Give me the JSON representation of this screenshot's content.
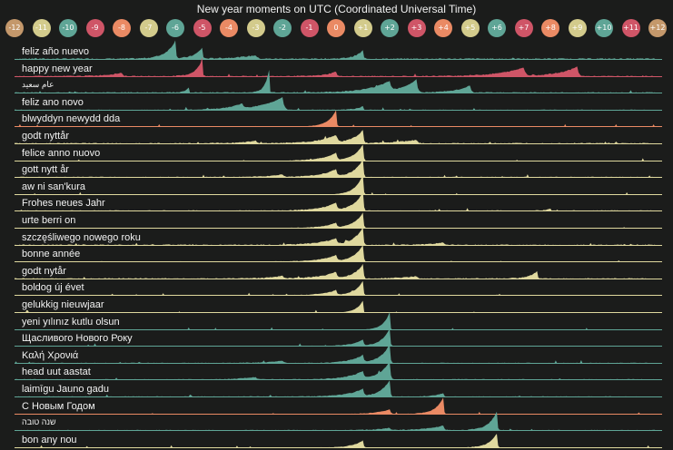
{
  "chart_data": {
    "type": "area",
    "title": "New year moments on UTC (Coordinated Universal Time)",
    "colors": {
      "green": "#5fa596",
      "red": "#cf5567",
      "orange": "#ea8a64",
      "yellow": "#dfd89e",
      "brown": "#c4986b",
      "background": "#1b1c1b"
    },
    "timezones": [
      {
        "label": "-12",
        "color": "#c4986b"
      },
      {
        "label": "-11",
        "color": "#d3cb8c"
      },
      {
        "label": "-10",
        "color": "#5fa596"
      },
      {
        "label": "-9",
        "color": "#cf5567"
      },
      {
        "label": "-8",
        "color": "#ea8a64"
      },
      {
        "label": "-7",
        "color": "#d3cb8c"
      },
      {
        "label": "-6",
        "color": "#5fa596"
      },
      {
        "label": "-5",
        "color": "#cf5567"
      },
      {
        "label": "-4",
        "color": "#ea8a64"
      },
      {
        "label": "-3",
        "color": "#d3cb8c"
      },
      {
        "label": "-2",
        "color": "#5fa596"
      },
      {
        "label": "-1",
        "color": "#cf5567"
      },
      {
        "label": "0",
        "color": "#ea8a64"
      },
      {
        "label": "+1",
        "color": "#d3cb8c"
      },
      {
        "label": "+2",
        "color": "#5fa596"
      },
      {
        "label": "+3",
        "color": "#cf5567"
      },
      {
        "label": "+4",
        "color": "#ea8a64"
      },
      {
        "label": "+5",
        "color": "#d3cb8c"
      },
      {
        "label": "+6",
        "color": "#5fa596"
      },
      {
        "label": "+7",
        "color": "#cf5567"
      },
      {
        "label": "+8",
        "color": "#ea8a64"
      },
      {
        "label": "+9",
        "color": "#d3cb8c"
      },
      {
        "label": "+10",
        "color": "#5fa596"
      },
      {
        "label": "+11",
        "color": "#cf5567"
      },
      {
        "label": "+12",
        "color": "#c4986b"
      }
    ],
    "xlim": [
      -12,
      12
    ],
    "series": [
      {
        "name": "feliz año nuevo",
        "color": "#5fa596",
        "base": 0.06,
        "peaks": [
          [
            -6,
            0.75,
            0.35
          ],
          [
            -5,
            0.45,
            0.3
          ],
          [
            1,
            0.35,
            0.3
          ],
          [
            -3,
            0.15,
            0.8
          ]
        ]
      },
      {
        "name": "happy new year",
        "color": "#cf5567",
        "base": 0.05,
        "peaks": [
          [
            -5,
            0.7,
            0.25
          ],
          [
            -8,
            0.15,
            0.6
          ],
          [
            7,
            0.35,
            0.9
          ],
          [
            9,
            0.4,
            0.7
          ],
          [
            0,
            0.2,
            0.4
          ]
        ]
      },
      {
        "name": "عام سعيد",
        "color": "#5fa596",
        "base": 0.05,
        "peaks": [
          [
            -2.5,
            1.0,
            0.15
          ],
          [
            2,
            0.4,
            0.8
          ],
          [
            3,
            0.55,
            0.6
          ],
          [
            5,
            0.3,
            0.5
          ],
          [
            -5.5,
            0.2,
            0.15
          ]
        ]
      },
      {
        "name": "feliz ano novo",
        "color": "#5fa596",
        "base": 0.04,
        "peaks": [
          [
            -2,
            0.55,
            0.8
          ],
          [
            -3.5,
            0.2,
            0.5
          ],
          [
            1,
            0.15,
            0.3
          ]
        ]
      },
      {
        "name": "blwyddyn newydd dda",
        "color": "#ea8a64",
        "base": 0.02,
        "peaks": [
          [
            0,
            0.7,
            0.3
          ]
        ]
      },
      {
        "name": "godt nyttår",
        "color": "#dfd89e",
        "base": 0.05,
        "peaks": [
          [
            1,
            0.55,
            0.4
          ],
          [
            0,
            0.3,
            0.7
          ],
          [
            3,
            0.15,
            0.8
          ],
          [
            -3,
            0.1,
            0.6
          ]
        ]
      },
      {
        "name": "felice anno nuovo",
        "color": "#dfd89e",
        "base": 0.03,
        "peaks": [
          [
            1,
            0.7,
            0.35
          ],
          [
            0,
            0.3,
            0.6
          ]
        ]
      },
      {
        "name": "gott nytt år",
        "color": "#dfd89e",
        "base": 0.04,
        "peaks": [
          [
            1,
            0.75,
            0.35
          ],
          [
            0,
            0.3,
            0.6
          ],
          [
            -2,
            0.1,
            0.6
          ]
        ]
      },
      {
        "name": "aw ni san'kura",
        "color": "#dfd89e",
        "base": 0.02,
        "peaks": [
          [
            1,
            0.85,
            0.3
          ]
        ]
      },
      {
        "name": "Frohes neues Jahr",
        "color": "#dfd89e",
        "base": 0.04,
        "peaks": [
          [
            1,
            0.8,
            0.35
          ],
          [
            0,
            0.3,
            0.6
          ],
          [
            8,
            0.08,
            0.2
          ]
        ]
      },
      {
        "name": "urte berri on",
        "color": "#dfd89e",
        "base": 0.03,
        "peaks": [
          [
            1,
            0.65,
            0.35
          ],
          [
            0,
            0.2,
            0.5
          ]
        ]
      },
      {
        "name": "szczęśliwego nowego roku",
        "color": "#dfd89e",
        "base": 0.05,
        "peaks": [
          [
            1,
            0.75,
            0.35
          ],
          [
            0,
            0.25,
            0.7
          ],
          [
            4,
            0.1,
            0.6
          ]
        ]
      },
      {
        "name": "bonne année",
        "color": "#dfd89e",
        "base": 0.03,
        "peaks": [
          [
            1,
            0.7,
            0.35
          ],
          [
            0,
            0.25,
            0.6
          ]
        ]
      },
      {
        "name": "godt nytår",
        "color": "#dfd89e",
        "base": 0.05,
        "peaks": [
          [
            1,
            0.6,
            0.35
          ],
          [
            0,
            0.25,
            0.6
          ],
          [
            7.5,
            0.3,
            0.3
          ],
          [
            3,
            0.1,
            0.6
          ],
          [
            -2,
            0.1,
            0.5
          ]
        ]
      },
      {
        "name": "boldog új évet",
        "color": "#dfd89e",
        "base": 0.03,
        "peaks": [
          [
            1,
            0.6,
            0.3
          ],
          [
            0,
            0.2,
            0.5
          ]
        ]
      },
      {
        "name": "gelukkig nieuwjaar",
        "color": "#dfd89e",
        "base": 0.02,
        "peaks": [
          [
            1,
            0.5,
            0.25
          ]
        ]
      },
      {
        "name": "yeni yılınız kutlu olsun",
        "color": "#5fa596",
        "base": 0.02,
        "peaks": [
          [
            2,
            0.75,
            0.25
          ]
        ]
      },
      {
        "name": "Щасливого Нового Року",
        "color": "#5fa596",
        "base": 0.03,
        "peaks": [
          [
            2,
            0.75,
            0.3
          ],
          [
            1,
            0.25,
            0.4
          ]
        ]
      },
      {
        "name": "Καλή Χρονιά",
        "color": "#5fa596",
        "base": 0.04,
        "peaks": [
          [
            2,
            0.8,
            0.35
          ],
          [
            1,
            0.3,
            0.5
          ],
          [
            -2,
            0.1,
            0.6
          ]
        ]
      },
      {
        "name": "head uut aastat",
        "color": "#5fa596",
        "base": 0.04,
        "peaks": [
          [
            2,
            0.75,
            0.4
          ],
          [
            1,
            0.3,
            0.6
          ],
          [
            -3,
            0.1,
            0.6
          ]
        ]
      },
      {
        "name": "laimīgu Jauno gadu",
        "color": "#5fa596",
        "base": 0.04,
        "peaks": [
          [
            2,
            0.7,
            0.35
          ],
          [
            1,
            0.3,
            0.6
          ],
          [
            4,
            0.15,
            0.3
          ]
        ]
      },
      {
        "name": "С Новым Годом",
        "color": "#ea8a64",
        "base": 0.03,
        "peaks": [
          [
            4,
            0.7,
            0.3
          ],
          [
            2,
            0.2,
            0.5
          ]
        ]
      },
      {
        "name": "שנה טובה",
        "color": "#5fa596",
        "base": 0.04,
        "peaks": [
          [
            6,
            0.8,
            0.3
          ],
          [
            4,
            0.2,
            0.6
          ],
          [
            2,
            0.1,
            0.5
          ]
        ]
      },
      {
        "name": "bon any nou",
        "color": "#dfd89e",
        "base": 0.03,
        "peaks": [
          [
            6,
            0.6,
            0.3
          ],
          [
            1,
            0.3,
            0.4
          ]
        ]
      }
    ]
  }
}
